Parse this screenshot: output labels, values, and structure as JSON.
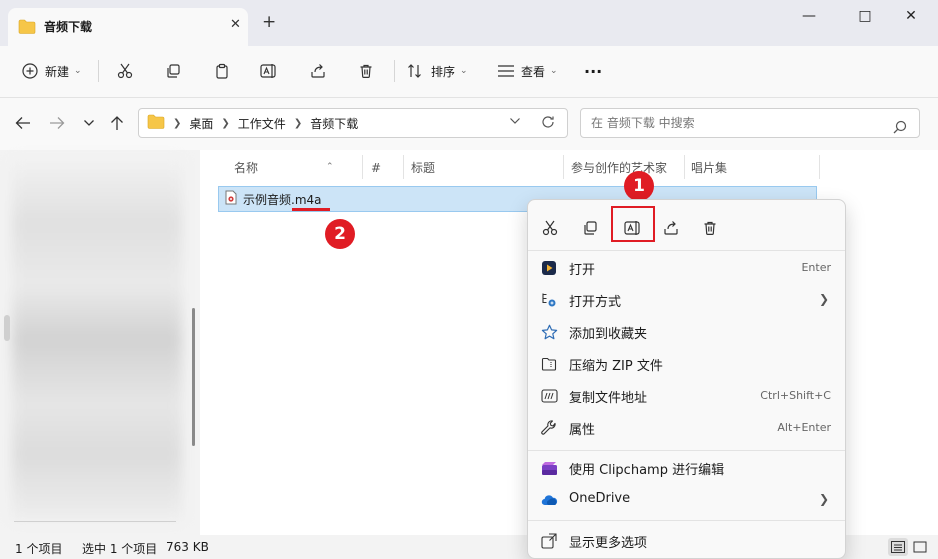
{
  "window": {
    "tab_title": "音频下载",
    "new_tab": "+",
    "close_tab": "✕",
    "minimize": "—",
    "maximize": "□",
    "close": "✕"
  },
  "toolbar": {
    "new_label": "新建",
    "sort_label": "排序",
    "view_label": "查看",
    "more": "···"
  },
  "address": {
    "crumbs": [
      "桌面",
      "工作文件",
      "音频下载"
    ]
  },
  "search": {
    "placeholder": "在 音频下载 中搜索"
  },
  "columns": {
    "name": "名称",
    "number": "#",
    "title": "标题",
    "artist": "参与创作的艺术家",
    "album": "唱片集"
  },
  "file": {
    "basename": "示例音频",
    "extension": ".m4a"
  },
  "annotations": {
    "badge1": "1",
    "badge2": "2",
    "color": "#e01c24"
  },
  "context_menu": {
    "items": [
      {
        "label": "打开",
        "accel": "Enter"
      },
      {
        "label": "打开方式",
        "accel": ""
      },
      {
        "label": "添加到收藏夹",
        "accel": ""
      },
      {
        "label": "压缩为 ZIP 文件",
        "accel": ""
      },
      {
        "label": "复制文件地址",
        "accel": "Ctrl+Shift+C"
      },
      {
        "label": "属性",
        "accel": "Alt+Enter"
      },
      {
        "label": "使用 Clipchamp 进行编辑",
        "accel": ""
      },
      {
        "label": "OneDrive",
        "accel": ""
      },
      {
        "label": "显示更多选项",
        "accel": ""
      }
    ]
  },
  "status": {
    "count": "1 个项目",
    "selected": "选中 1 个项目",
    "size": "763 KB"
  }
}
